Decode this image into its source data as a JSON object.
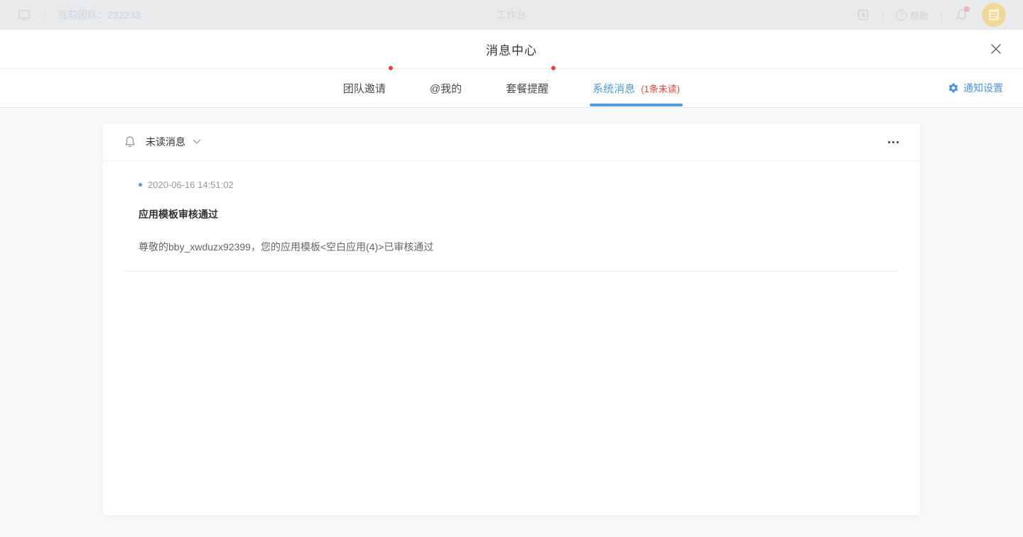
{
  "topbar": {
    "team_label": "当前团队：232233",
    "title": "工作台",
    "help_label": "帮助"
  },
  "modal": {
    "title": "消息中心"
  },
  "tabs": {
    "items": [
      {
        "label": "团队邀请",
        "has_unread_dot": true
      },
      {
        "label": "@我的",
        "has_unread_dot": false
      },
      {
        "label": "套餐提醒",
        "has_unread_dot": true
      },
      {
        "label": "系统消息",
        "unread": "(1条未读)",
        "active": true
      }
    ],
    "settings_label": "通知设置"
  },
  "panel": {
    "filter_label": "未读消息",
    "message": {
      "timestamp": "2020-06-16 14:51:02",
      "title": "应用模板审核通过",
      "body": "尊敬的bby_xwduzx92399，您的应用模板<空白应用(4)>已审核通过"
    }
  },
  "colors": {
    "accent_blue": "#4e9be6",
    "settings_blue": "#4a90e2",
    "unread_red": "#f04134",
    "content_bg": "#f7f8f9"
  }
}
